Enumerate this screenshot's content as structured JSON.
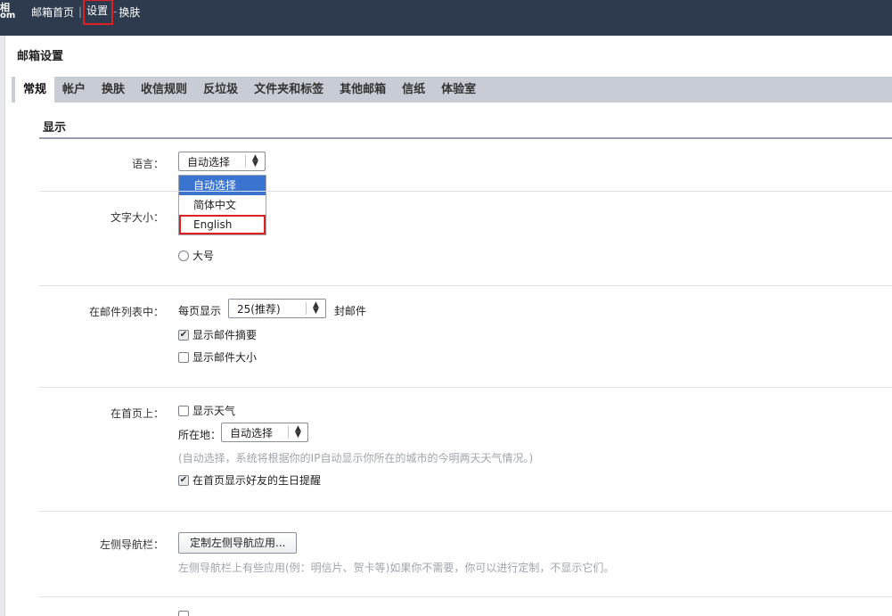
{
  "topbar": {
    "logo_line1": "相",
    "logo_line2": "om",
    "nav": [
      "邮箱首页",
      "设置",
      "换肤"
    ],
    "separator": "|",
    "separator2": "-"
  },
  "page": {
    "title": "邮箱设置"
  },
  "tabs": [
    "常规",
    "帐户",
    "换肤",
    "收信规则",
    "反垃圾",
    "文件夹和标签",
    "其他邮箱",
    "信纸",
    "体验室"
  ],
  "display": {
    "section_title": "显示",
    "language": {
      "label": "语言：",
      "selected": "自动选择",
      "options": [
        "自动选择",
        "简体中文",
        "English"
      ]
    },
    "font_size": {
      "label": "文字大小：",
      "large_option": "大号"
    },
    "mail_list": {
      "label": "在邮件列表中：",
      "per_page_prefix": "每页显示",
      "per_page_value": "25(推荐)",
      "per_page_suffix": "封邮件",
      "show_summary": "显示邮件摘要",
      "show_size": "显示邮件大小"
    },
    "homepage": {
      "label": "在首页上：",
      "show_weather": "显示天气",
      "location_label": "所在地：",
      "location_value": "自动选择",
      "weather_hint": "(自动选择，系统将根据你的IP自动显示你所在的城市的今明两天天气情况。)",
      "birthday": "在首页显示好友的生日提醒"
    },
    "left_nav": {
      "label": "左侧导航栏：",
      "button": "定制左侧导航应用...",
      "hint": "左侧导航栏上有些应用(例：明信片、贺卡等)如果你不需要，你可以进行定制，不显示它们。"
    }
  }
}
